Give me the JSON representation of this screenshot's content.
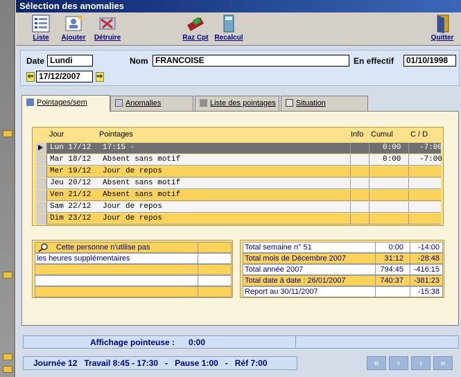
{
  "window": {
    "title": "Sélection des anomalies"
  },
  "toolbar": {
    "liste": "Liste",
    "ajouter": "Ajouter",
    "detruire": "Détruire",
    "raz_cpt": "Raz Cpt",
    "recalcul": "Recalcul",
    "quitter": "Quitter"
  },
  "header": {
    "date_label": "Date",
    "day_value": "Lundi",
    "date_value": "17/12/2007",
    "nom_label": "Nom",
    "nom_value": "FRANCOISE",
    "effectif_label": "En effectif",
    "effectif_value": "01/10/1998"
  },
  "tabs": [
    "Pointages/sem",
    "Anomalies",
    "Liste des pointages",
    "Situation"
  ],
  "grid": {
    "headers": {
      "jour": "Jour",
      "pointages": "Pointages",
      "info": "Info",
      "cumul": "Cumul",
      "cd": "C / D"
    },
    "rows": [
      {
        "jour": "Lun 17/12",
        "pointages": "17:15 -",
        "info": "",
        "cumul": "0:00",
        "cd": "-7:00"
      },
      {
        "jour": "Mar 18/12",
        "pointages": "Absent sans motif",
        "info": "",
        "cumul": "0:00",
        "cd": "-7:00"
      },
      {
        "jour": "Mer 19/12",
        "pointages": "Jour de repos",
        "info": "",
        "cumul": "",
        "cd": ""
      },
      {
        "jour": "Jeu 20/12",
        "pointages": "Absent sans motif",
        "info": "",
        "cumul": "",
        "cd": ""
      },
      {
        "jour": "Ven 21/12",
        "pointages": "Absent sans motif",
        "info": "",
        "cumul": "",
        "cd": ""
      },
      {
        "jour": "Sam 22/12",
        "pointages": "Jour de repos",
        "info": "",
        "cumul": "",
        "cd": ""
      },
      {
        "jour": "Dim 23/12",
        "pointages": "Jour de repos",
        "info": "",
        "cumul": "",
        "cd": ""
      }
    ]
  },
  "note": {
    "line1": "Cette personne n'utilise pas",
    "line2": "les heures supplémentaires"
  },
  "totals": [
    {
      "label": "Total semaine n° 51",
      "cumul": "0:00",
      "cd": "-14:00"
    },
    {
      "label": "Total mois de Décembre 2007",
      "cumul": "31:12",
      "cd": "-28:48"
    },
    {
      "label": "Total année 2007",
      "cumul": "794:45",
      "cd": "-416:15"
    },
    {
      "label": "Total date à date : 26/01/2007",
      "cumul": "740:37",
      "cd": "-381:23"
    },
    {
      "label": "Report au 30/11/2007",
      "cumul": "",
      "cd": "-15:38"
    }
  ],
  "affichage": {
    "label": "Affichage pointeuse :",
    "value": "0:00"
  },
  "status": {
    "text": "Journée 12   Travail 8:45 - 17:30   -   Pause 1:00   -   Réf 7:00"
  },
  "nav": {
    "first": "«",
    "prev": "‹",
    "next": "›",
    "last": "»"
  }
}
